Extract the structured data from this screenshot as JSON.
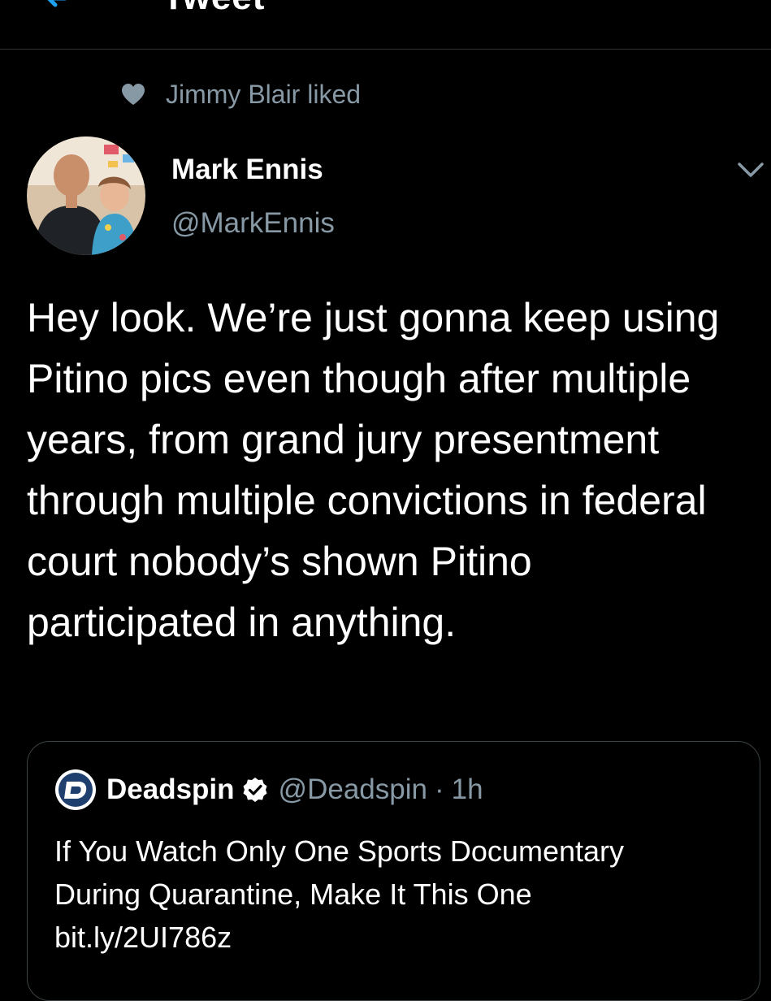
{
  "header": {
    "title": "Tweet",
    "back_icon": "back-arrow-icon"
  },
  "social_context": {
    "icon": "heart-icon",
    "text": "Jimmy Blair liked"
  },
  "tweet": {
    "author_name": "Mark Ennis",
    "author_handle": "@MarkEnnis",
    "menu_icon": "chevron-down-icon",
    "text": "Hey look. We’re just gonna keep using Pitino pics even though after multiple years, from grand jury presentment through multiple convictions in federal court nobody’s shown Pitino participated in anything."
  },
  "quoted_tweet": {
    "logo_icon": "deadspin-logo-icon",
    "name": "Deadspin",
    "verified_icon": "verified-badge-icon",
    "handle": "@Deadspin",
    "separator": "·",
    "time": "1h",
    "text": "If You Watch Only One Sports Documentary During Quarantine, Make It This One bit.ly/2UI786z"
  },
  "colors": {
    "background": "#000000",
    "text_primary": "#ffffff",
    "text_secondary": "#8899a6",
    "accent": "#1da1f2",
    "border": "#3d4448"
  }
}
